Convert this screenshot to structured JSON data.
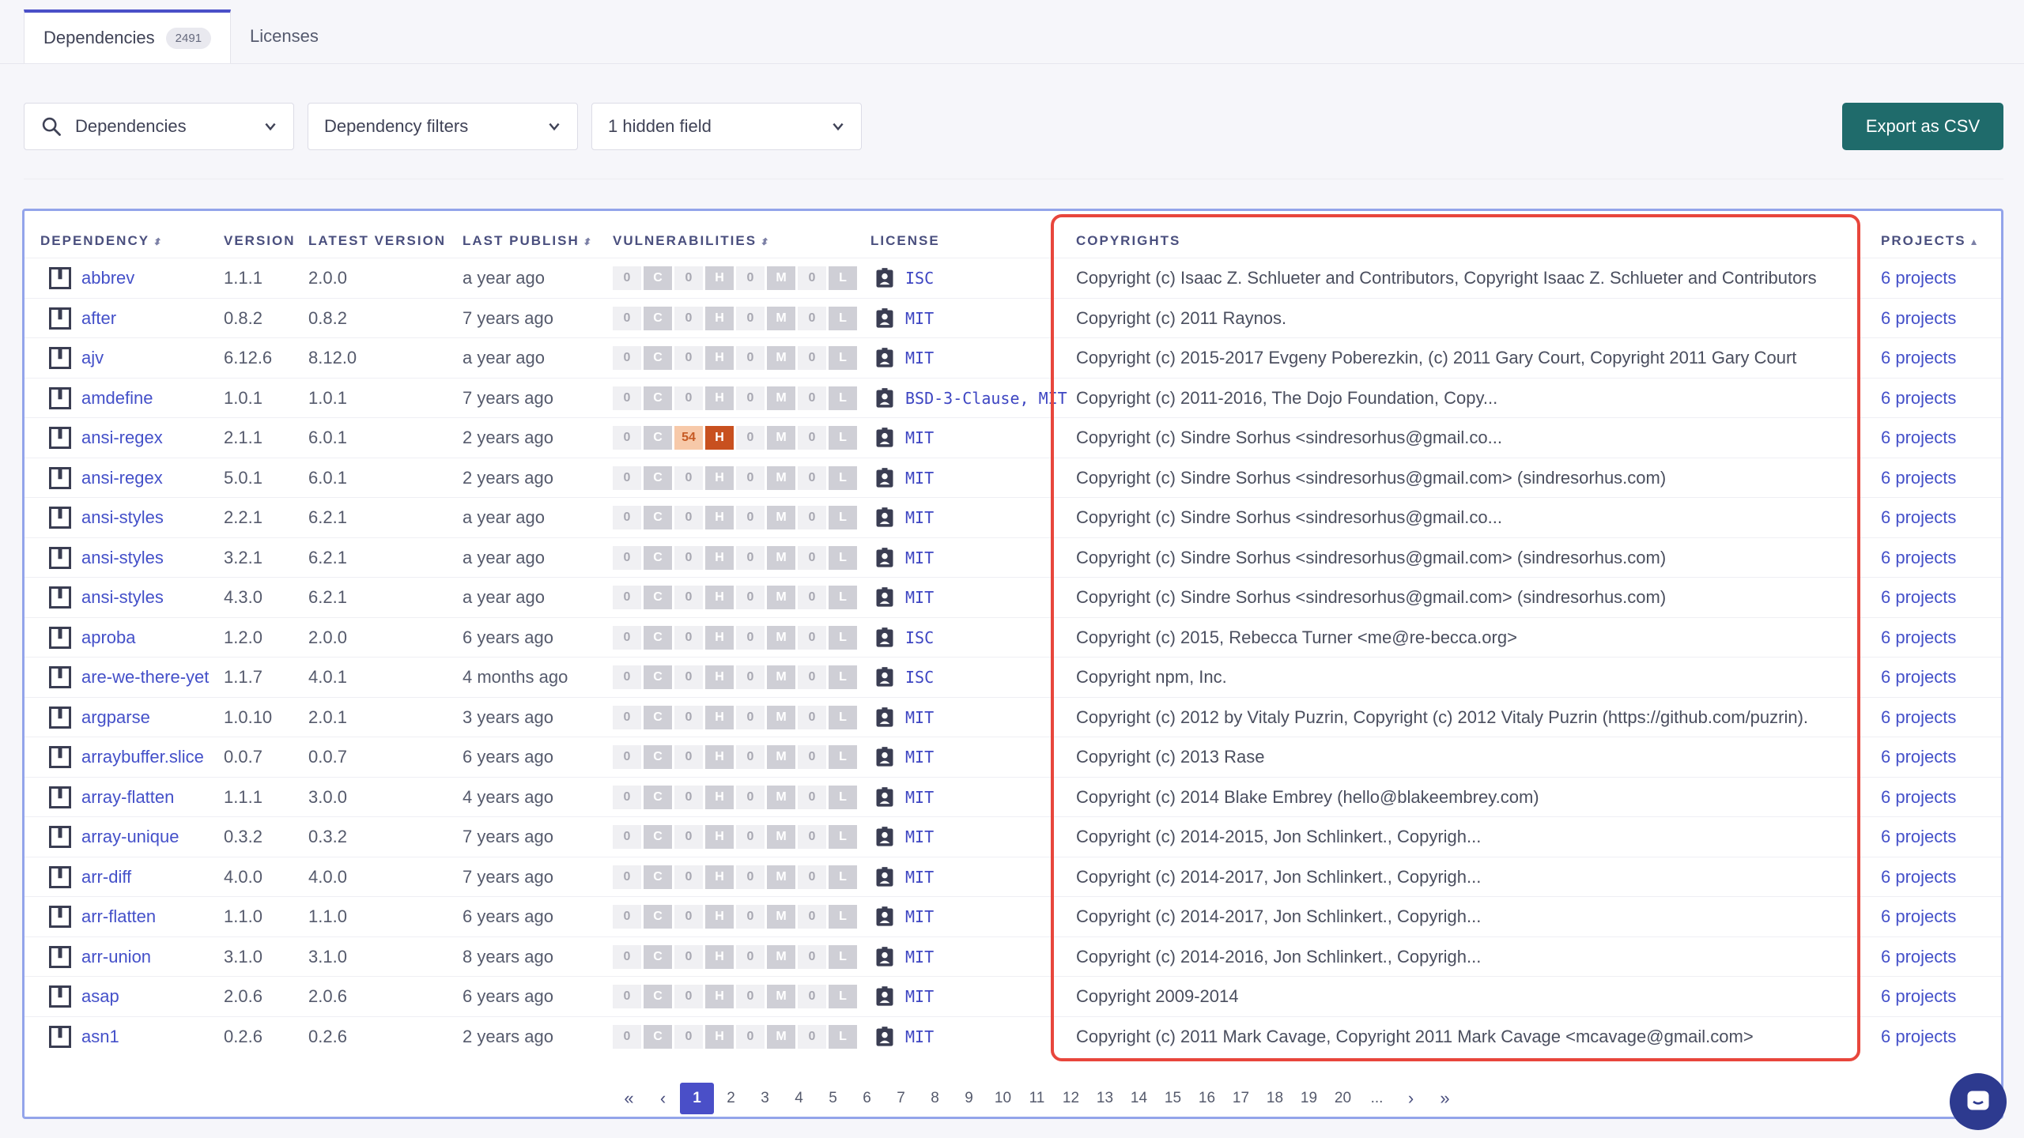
{
  "tabs": [
    {
      "label": "Dependencies",
      "badge": "2491"
    },
    {
      "label": "Licenses"
    }
  ],
  "toolbar": {
    "search_label": "Dependencies",
    "filter_label": "Dependency filters",
    "hidden_label": "1 hidden field",
    "export_label": "Export as CSV"
  },
  "columns": {
    "dependency": "DEPENDENCY",
    "version": "VERSION",
    "latest": "LATEST VERSION",
    "publish": "LAST PUBLISH",
    "vulns": "VULNERABILITIES",
    "license": "LICENSE",
    "copyrights": "COPYRIGHTS",
    "projects": "PROJECTS"
  },
  "rows": [
    {
      "name": "abbrev",
      "version": "1.1.1",
      "latest": "2.0.0",
      "publish": "a year ago",
      "v": [
        "0",
        "C",
        "0",
        "H",
        "0",
        "M",
        "0",
        "L"
      ],
      "license": "ISC",
      "copyright": "Copyright (c) Isaac Z. Schlueter and Contributors, Copyright Isaac Z. Schlueter and Contributors",
      "projects": "6 projects"
    },
    {
      "name": "after",
      "version": "0.8.2",
      "latest": "0.8.2",
      "publish": "7 years ago",
      "v": [
        "0",
        "C",
        "0",
        "H",
        "0",
        "M",
        "0",
        "L"
      ],
      "license": "MIT",
      "copyright": "Copyright (c) 2011 Raynos.",
      "projects": "6 projects"
    },
    {
      "name": "ajv",
      "version": "6.12.6",
      "latest": "8.12.0",
      "publish": "a year ago",
      "v": [
        "0",
        "C",
        "0",
        "H",
        "0",
        "M",
        "0",
        "L"
      ],
      "license": "MIT",
      "copyright": "Copyright (c) 2015-2017 Evgeny Poberezkin, (c) 2011 Gary Court, Copyright 2011 Gary Court",
      "projects": "6 projects"
    },
    {
      "name": "amdefine",
      "version": "1.0.1",
      "latest": "1.0.1",
      "publish": "7 years ago",
      "v": [
        "0",
        "C",
        "0",
        "H",
        "0",
        "M",
        "0",
        "L"
      ],
      "license": "BSD-3-Clause, MIT",
      "copyright": "Copyright (c) 2011-2016, The Dojo Foundation, Copy...",
      "projects": "6 projects"
    },
    {
      "name": "ansi-regex",
      "version": "2.1.1",
      "latest": "6.0.1",
      "publish": "2 years ago",
      "v": [
        "0",
        "C",
        "54",
        "H",
        "0",
        "M",
        "0",
        "L"
      ],
      "license": "MIT",
      "copyright": "Copyright (c) Sindre Sorhus <sindresorhus@gmail.co...",
      "projects": "6 projects"
    },
    {
      "name": "ansi-regex",
      "version": "5.0.1",
      "latest": "6.0.1",
      "publish": "2 years ago",
      "v": [
        "0",
        "C",
        "0",
        "H",
        "0",
        "M",
        "0",
        "L"
      ],
      "license": "MIT",
      "copyright": "Copyright (c) Sindre Sorhus <sindresorhus@gmail.com> (sindresorhus.com)",
      "projects": "6 projects"
    },
    {
      "name": "ansi-styles",
      "version": "2.2.1",
      "latest": "6.2.1",
      "publish": "a year ago",
      "v": [
        "0",
        "C",
        "0",
        "H",
        "0",
        "M",
        "0",
        "L"
      ],
      "license": "MIT",
      "copyright": "Copyright (c) Sindre Sorhus <sindresorhus@gmail.co...",
      "projects": "6 projects"
    },
    {
      "name": "ansi-styles",
      "version": "3.2.1",
      "latest": "6.2.1",
      "publish": "a year ago",
      "v": [
        "0",
        "C",
        "0",
        "H",
        "0",
        "M",
        "0",
        "L"
      ],
      "license": "MIT",
      "copyright": "Copyright (c) Sindre Sorhus <sindresorhus@gmail.com> (sindresorhus.com)",
      "projects": "6 projects"
    },
    {
      "name": "ansi-styles",
      "version": "4.3.0",
      "latest": "6.2.1",
      "publish": "a year ago",
      "v": [
        "0",
        "C",
        "0",
        "H",
        "0",
        "M",
        "0",
        "L"
      ],
      "license": "MIT",
      "copyright": "Copyright (c) Sindre Sorhus <sindresorhus@gmail.com> (sindresorhus.com)",
      "projects": "6 projects"
    },
    {
      "name": "aproba",
      "version": "1.2.0",
      "latest": "2.0.0",
      "publish": "6 years ago",
      "v": [
        "0",
        "C",
        "0",
        "H",
        "0",
        "M",
        "0",
        "L"
      ],
      "license": "ISC",
      "copyright": "Copyright (c) 2015, Rebecca Turner <me@re-becca.org>",
      "projects": "6 projects"
    },
    {
      "name": "are-we-there-yet",
      "version": "1.1.7",
      "latest": "4.0.1",
      "publish": "4 months ago",
      "v": [
        "0",
        "C",
        "0",
        "H",
        "0",
        "M",
        "0",
        "L"
      ],
      "license": "ISC",
      "copyright": "Copyright npm, Inc.",
      "projects": "6 projects"
    },
    {
      "name": "argparse",
      "version": "1.0.10",
      "latest": "2.0.1",
      "publish": "3 years ago",
      "v": [
        "0",
        "C",
        "0",
        "H",
        "0",
        "M",
        "0",
        "L"
      ],
      "license": "MIT",
      "copyright": "Copyright (c) 2012 by Vitaly Puzrin, Copyright (c) 2012 Vitaly Puzrin (https://github.com/puzrin).",
      "projects": "6 projects"
    },
    {
      "name": "arraybuffer.slice",
      "version": "0.0.7",
      "latest": "0.0.7",
      "publish": "6 years ago",
      "v": [
        "0",
        "C",
        "0",
        "H",
        "0",
        "M",
        "0",
        "L"
      ],
      "license": "MIT",
      "copyright": "Copyright (c) 2013 Rase",
      "projects": "6 projects"
    },
    {
      "name": "array-flatten",
      "version": "1.1.1",
      "latest": "3.0.0",
      "publish": "4 years ago",
      "v": [
        "0",
        "C",
        "0",
        "H",
        "0",
        "M",
        "0",
        "L"
      ],
      "license": "MIT",
      "copyright": "Copyright (c) 2014 Blake Embrey (hello@blakeembrey.com)",
      "projects": "6 projects"
    },
    {
      "name": "array-unique",
      "version": "0.3.2",
      "latest": "0.3.2",
      "publish": "7 years ago",
      "v": [
        "0",
        "C",
        "0",
        "H",
        "0",
        "M",
        "0",
        "L"
      ],
      "license": "MIT",
      "copyright": "Copyright (c) 2014-2015, Jon Schlinkert., Copyrigh...",
      "projects": "6 projects"
    },
    {
      "name": "arr-diff",
      "version": "4.0.0",
      "latest": "4.0.0",
      "publish": "7 years ago",
      "v": [
        "0",
        "C",
        "0",
        "H",
        "0",
        "M",
        "0",
        "L"
      ],
      "license": "MIT",
      "copyright": "Copyright (c) 2014-2017, Jon Schlinkert., Copyrigh...",
      "projects": "6 projects"
    },
    {
      "name": "arr-flatten",
      "version": "1.1.0",
      "latest": "1.1.0",
      "publish": "6 years ago",
      "v": [
        "0",
        "C",
        "0",
        "H",
        "0",
        "M",
        "0",
        "L"
      ],
      "license": "MIT",
      "copyright": "Copyright (c) 2014-2017, Jon Schlinkert., Copyrigh...",
      "projects": "6 projects"
    },
    {
      "name": "arr-union",
      "version": "3.1.0",
      "latest": "3.1.0",
      "publish": "8 years ago",
      "v": [
        "0",
        "C",
        "0",
        "H",
        "0",
        "M",
        "0",
        "L"
      ],
      "license": "MIT",
      "copyright": "Copyright (c) 2014-2016, Jon Schlinkert., Copyrigh...",
      "projects": "6 projects"
    },
    {
      "name": "asap",
      "version": "2.0.6",
      "latest": "2.0.6",
      "publish": "6 years ago",
      "v": [
        "0",
        "C",
        "0",
        "H",
        "0",
        "M",
        "0",
        "L"
      ],
      "license": "MIT",
      "copyright": "Copyright 2009-2014",
      "projects": "6 projects"
    },
    {
      "name": "asn1",
      "version": "0.2.6",
      "latest": "0.2.6",
      "publish": "2 years ago",
      "v": [
        "0",
        "C",
        "0",
        "H",
        "0",
        "M",
        "0",
        "L"
      ],
      "license": "MIT",
      "copyright": "Copyright (c) 2011 Mark Cavage, Copyright 2011 Mark Cavage <mcavage@gmail.com>",
      "projects": "6 projects"
    }
  ],
  "pagination": {
    "pages": [
      "1",
      "2",
      "3",
      "4",
      "5",
      "6",
      "7",
      "8",
      "9",
      "10",
      "11",
      "12",
      "13",
      "14",
      "15",
      "16",
      "17",
      "18",
      "19",
      "20",
      "..."
    ],
    "current": "1"
  },
  "colors": {
    "accent": "#4a4fc8",
    "export": "#1f6b6b",
    "highlight": "#e8463c",
    "high_severity": "#c8501f"
  }
}
